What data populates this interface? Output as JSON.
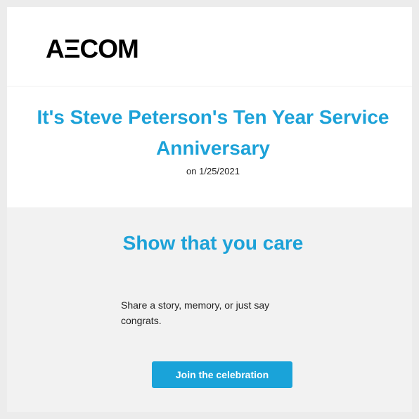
{
  "logo": {
    "text": "AΞCOM"
  },
  "hero": {
    "title": "It's Steve Peterson's Ten Year Service Anniversary",
    "date": "on 1/25/2021"
  },
  "care": {
    "title": "Show that you care",
    "text": "Share a story, memory, or just say congrats.",
    "button_label": "Join the celebration"
  },
  "colors": {
    "accent": "#1da2d8",
    "button": "#1aa3d9",
    "background": "#ececec",
    "section_bg": "#f2f2f2"
  }
}
